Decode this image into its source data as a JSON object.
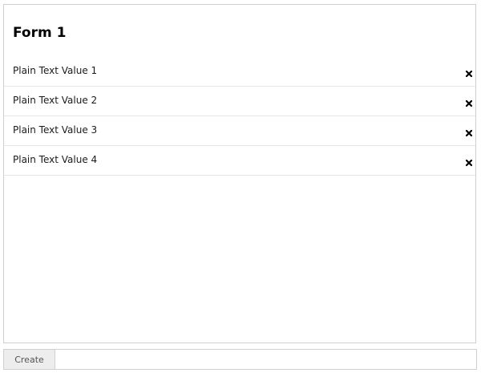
{
  "form": {
    "title": "Form 1",
    "rows": [
      {
        "label": "Plain Text Value 1"
      },
      {
        "label": "Plain Text Value 2"
      },
      {
        "label": "Plain Text Value 3"
      },
      {
        "label": "Plain Text Value 4"
      }
    ],
    "remove_icon": "close-x-icon"
  },
  "footer": {
    "create_label": "Create"
  }
}
